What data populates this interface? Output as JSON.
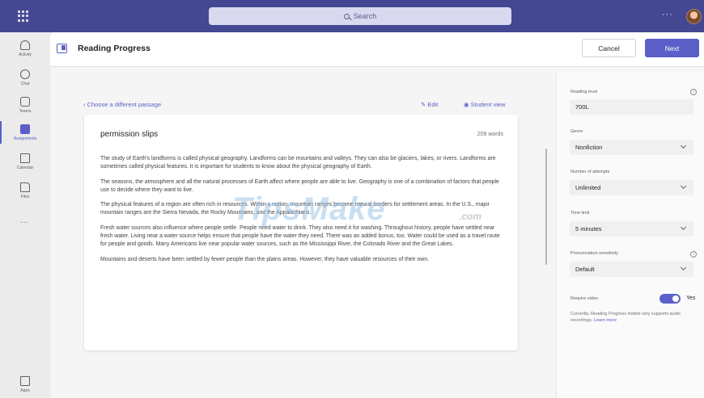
{
  "topbar": {
    "search_placeholder": "Search",
    "more_label": "···"
  },
  "rail": {
    "items": [
      {
        "label": "Activity",
        "icon": "bell-icon"
      },
      {
        "label": "Chat",
        "icon": "chat-icon"
      },
      {
        "label": "Teams",
        "icon": "teams-icon"
      },
      {
        "label": "Assignments",
        "icon": "assignments-icon"
      },
      {
        "label": "Calendar",
        "icon": "calendar-icon"
      },
      {
        "label": "Files",
        "icon": "files-icon"
      }
    ],
    "more_label": "···",
    "apps_label": "Apps"
  },
  "header": {
    "title": "Reading Progress",
    "cancel_label": "Cancel",
    "next_label": "Next"
  },
  "content": {
    "back_label": "Choose a different passage",
    "edit_label": "Edit",
    "student_view_label": "Student view",
    "passage_title": "permission slips",
    "word_count": "209 words",
    "paragraphs": [
      "The study of Earth's landforms is called physical geography. Landforms can be mountains and valleys. They can also be glaciers, lakes, or rivers. Landforms are sometimes called physical features. It is important for students to know about the physical geography of Earth.",
      "The seasons, the atmosphere and all the natural processes of Earth affect where people are able to live. Geography is one of a combination of factors that people use to decide where they want to live.",
      "The physical features of a region are often rich in resources. Within a nation, mountain ranges become natural borders for settlement areas. In the U.S., major mountain ranges are the Sierra Nevada, the Rocky Mountains, and the Appalachians.",
      "Fresh water sources also influence where people settle. People need water to drink. They also need it for washing. Throughout history, people have settled near fresh water. Living near a water source helps ensure that people have the water they need. There was an added bonus, too. Water could be used as a travel route for people and goods. Many Americans live near popular water sources, such as the Mississippi River, the Colorado River and the Great Lakes.",
      "Mountains and deserts have been settled by fewer people than the plains areas. However, they have valuable resources of their own."
    ],
    "watermark": "TipsMake",
    "watermark_suffix": ".com"
  },
  "settings": {
    "reading_level_label": "Reading level",
    "reading_level_value": "700L",
    "genre_label": "Genre",
    "genre_value": "Nonfiction",
    "attempts_label": "Number of attempts",
    "attempts_value": "Unlimited",
    "time_limit_label": "Time limit",
    "time_limit_value": "5 minutes",
    "pronunciation_label": "Pronunciation sensitivity",
    "pronunciation_value": "Default",
    "require_video_label": "Require video",
    "require_video_state": "Yes",
    "note_text": "Currently, Reading Progress mobile only supports audio recordings.",
    "note_link": "Learn more"
  },
  "colors": {
    "accent": "#5b5fc7",
    "topbar": "#444791"
  }
}
